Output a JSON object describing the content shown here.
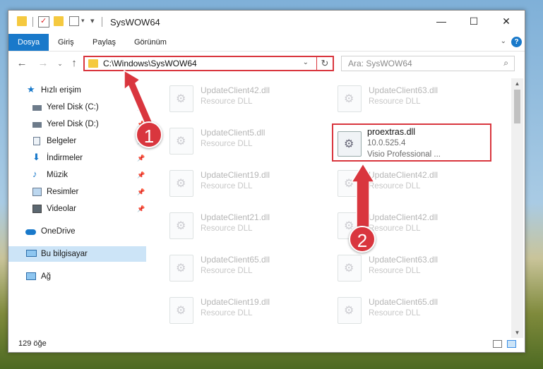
{
  "window": {
    "title": "SysWOW64"
  },
  "window_controls": {
    "minimize": "—",
    "maximize": "☐",
    "close": "✕"
  },
  "ribbon": {
    "tabs": [
      "Dosya",
      "Giriş",
      "Paylaş",
      "Görünüm"
    ]
  },
  "address": {
    "path": "C:\\Windows\\SysWOW64"
  },
  "search": {
    "placeholder": "Ara: SysWOW64"
  },
  "nav_pane": {
    "items": [
      {
        "label": "Hızlı erişim",
        "icon": "star-icon"
      },
      {
        "label": "Yerel Disk (C:)",
        "icon": "drive-icon"
      },
      {
        "label": "Yerel Disk (D:)",
        "icon": "drive-icon"
      },
      {
        "label": "Belgeler",
        "icon": "documents-icon"
      },
      {
        "label": "İndirmeler",
        "icon": "download-icon"
      },
      {
        "label": "Müzik",
        "icon": "music-icon"
      },
      {
        "label": "Resimler",
        "icon": "pictures-icon"
      },
      {
        "label": "Videolar",
        "icon": "video-icon"
      },
      {
        "label": "OneDrive",
        "icon": "cloud-icon"
      },
      {
        "label": "Bu bilgisayar",
        "icon": "computer-icon"
      },
      {
        "label": "Ağ",
        "icon": "network-icon"
      }
    ]
  },
  "files_left": [
    {
      "name": "UpdateClient42.dll",
      "desc": "Resource DLL"
    },
    {
      "name": "UpdateClient5.dll",
      "desc": "Resource DLL"
    },
    {
      "name": "UpdateClient19.dll",
      "desc": "Resource DLL"
    },
    {
      "name": "UpdateClient21.dll",
      "desc": "Resource DLL"
    },
    {
      "name": "UpdateClient65.dll",
      "desc": "Resource DLL"
    },
    {
      "name": "UpdateClient19.dll",
      "desc": "Resource DLL"
    }
  ],
  "files_right": [
    {
      "name": "UpdateClient63.dll",
      "desc": "Resource DLL"
    },
    {
      "name": "UpdateClient42.dll",
      "desc": "Resource DLL"
    },
    {
      "name": "UpdateClient42.dll",
      "desc": "Resource DLL"
    },
    {
      "name": "UpdateClient63.dll",
      "desc": "Resource DLL"
    },
    {
      "name": "UpdateClient65.dll",
      "desc": "Resource DLL"
    }
  ],
  "featured_file": {
    "name": "proextras.dll",
    "version": "10.0.525.4",
    "desc": "Visio Professional ..."
  },
  "annotations": {
    "badge1": "1",
    "badge2": "2",
    "accent": "#d9363e"
  },
  "status": {
    "count": "129 öğe"
  }
}
